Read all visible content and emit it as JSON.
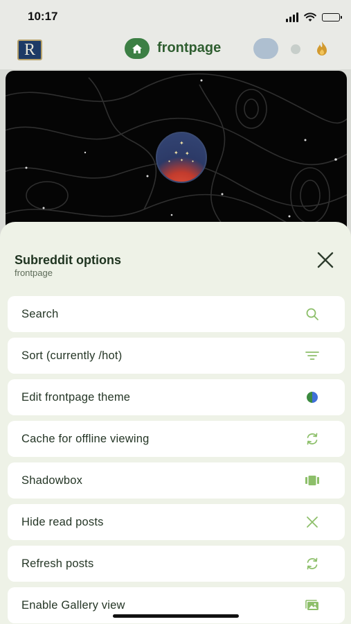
{
  "status_bar": {
    "time": "10:17"
  },
  "header": {
    "logo_letter": "R",
    "title": "frontpage"
  },
  "sheet": {
    "title": "Subreddit options",
    "subtitle": "frontpage",
    "close_icon": "close-icon",
    "options": [
      {
        "label": "Search",
        "icon": "search-icon"
      },
      {
        "label": "Sort (currently /hot)",
        "icon": "sort-icon"
      },
      {
        "label": "Edit frontpage theme",
        "icon": "theme-icon"
      },
      {
        "label": "Cache for offline viewing",
        "icon": "sync-icon"
      },
      {
        "label": "Shadowbox",
        "icon": "shadowbox-icon"
      },
      {
        "label": "Hide read posts",
        "icon": "close-icon"
      },
      {
        "label": "Refresh posts",
        "icon": "refresh-icon"
      },
      {
        "label": "Enable Gallery view",
        "icon": "gallery-icon"
      }
    ]
  },
  "colors": {
    "accent": "#8dbf6a",
    "sheet_background": "#eef2e7",
    "header_green": "#3c7f44"
  }
}
